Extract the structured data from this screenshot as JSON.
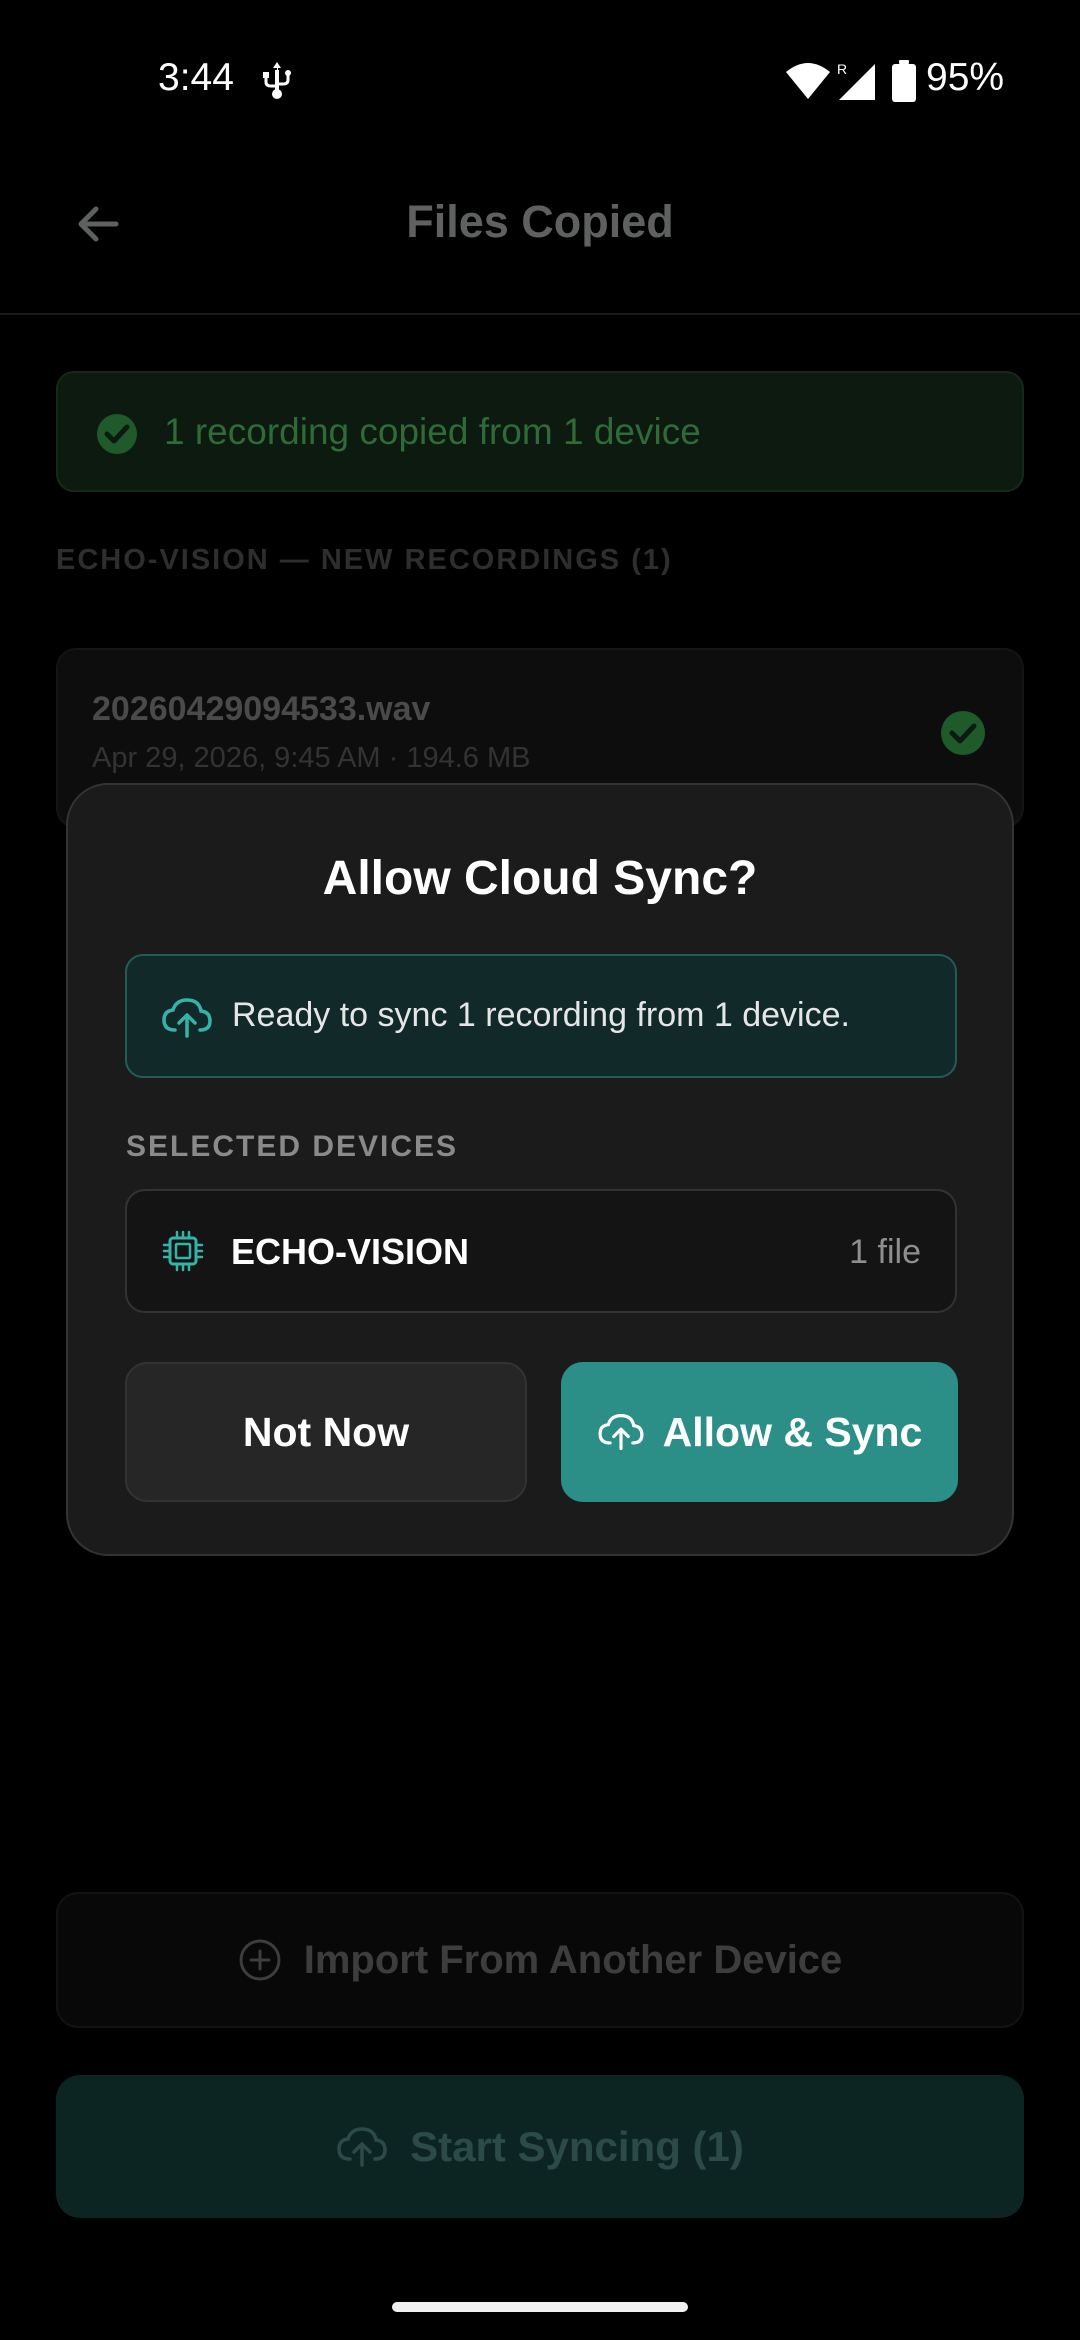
{
  "status_bar": {
    "time": "3:44",
    "signal_badge": "R",
    "battery": "95%"
  },
  "header": {
    "title": "Files Copied"
  },
  "banner": {
    "text": "1 recording copied from 1 device"
  },
  "section": {
    "header": "ECHO-VISION — NEW RECORDINGS (1)"
  },
  "files": [
    {
      "name": "20260429094533.wav",
      "meta": "Apr 29, 2026, 9:45 AM · 194.6 MB"
    }
  ],
  "footer": {
    "import_label": "Import From Another Device",
    "start_label": "Start Syncing (1)"
  },
  "dialog": {
    "title": "Allow Cloud Sync?",
    "info": "Ready to sync 1 recording from 1 device.",
    "devices_label": "SELECTED DEVICES",
    "devices": [
      {
        "name": "ECHO-VISION",
        "count": "1 file"
      }
    ],
    "cancel_label": "Not Now",
    "confirm_label": "Allow & Sync"
  },
  "colors": {
    "accent": "#2b8f88",
    "success": "#2f6a38",
    "background": "#000000",
    "dialog": "#1b1b1b"
  }
}
